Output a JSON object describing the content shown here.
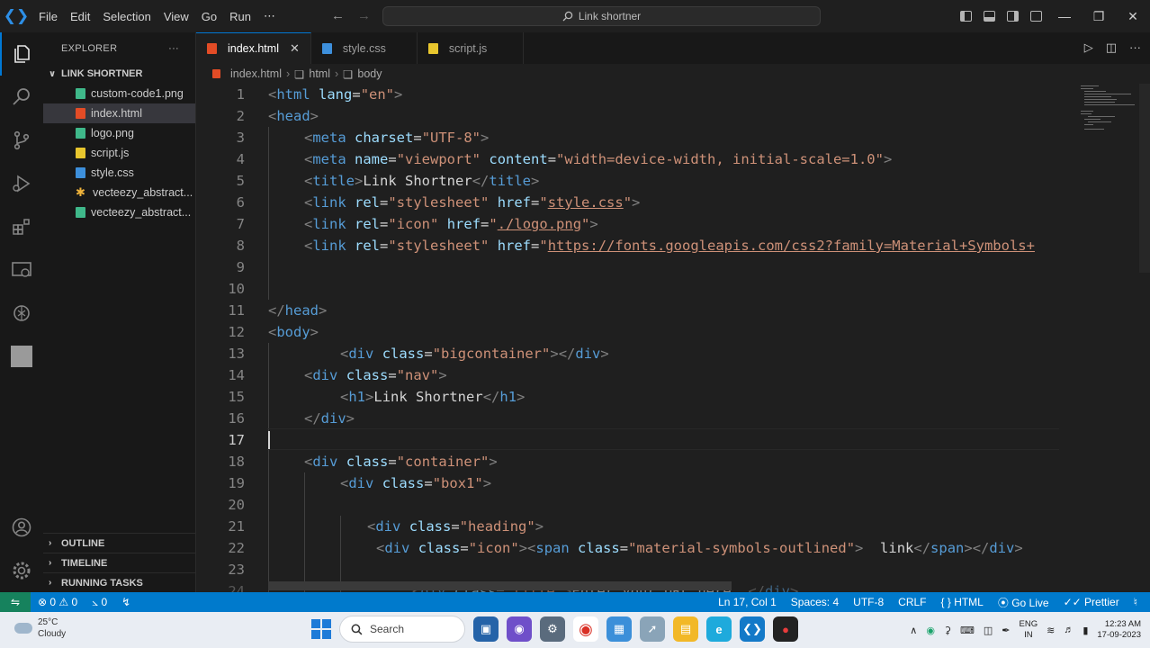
{
  "menu": [
    "File",
    "Edit",
    "Selection",
    "View",
    "Go",
    "Run",
    "⋯"
  ],
  "command_center": "Link shortner",
  "explorer": {
    "title": "EXPLORER",
    "more": "···",
    "folder": "LINK SHORTNER",
    "files": [
      {
        "name": "custom-code1.png",
        "type": "img"
      },
      {
        "name": "index.html",
        "type": "html",
        "selected": true
      },
      {
        "name": "logo.png",
        "type": "img"
      },
      {
        "name": "script.js",
        "type": "js"
      },
      {
        "name": "style.css",
        "type": "css"
      },
      {
        "name": "vecteezy_abstract...",
        "type": "star"
      },
      {
        "name": "vecteezy_abstract...",
        "type": "img"
      }
    ],
    "sections": [
      "OUTLINE",
      "TIMELINE",
      "RUNNING TASKS"
    ]
  },
  "tabs": [
    {
      "label": "index.html",
      "active": true,
      "type": "html"
    },
    {
      "label": "style.css",
      "active": false,
      "type": "css"
    },
    {
      "label": "script.js",
      "active": false,
      "type": "js"
    }
  ],
  "breadcrumbs": [
    "index.html",
    "html",
    "body"
  ],
  "code_lines": [
    {
      "n": "1"
    },
    {
      "n": "2"
    },
    {
      "n": "3"
    },
    {
      "n": "4"
    },
    {
      "n": "5"
    },
    {
      "n": "6"
    },
    {
      "n": "7"
    },
    {
      "n": "8"
    },
    {
      "n": "9"
    },
    {
      "n": "10"
    },
    {
      "n": "11"
    },
    {
      "n": "12"
    },
    {
      "n": "13"
    },
    {
      "n": "14"
    },
    {
      "n": "15"
    },
    {
      "n": "16"
    },
    {
      "n": "17"
    },
    {
      "n": "18"
    },
    {
      "n": "19"
    },
    {
      "n": "20"
    },
    {
      "n": "21"
    },
    {
      "n": "22"
    },
    {
      "n": "23"
    },
    {
      "n": "24"
    }
  ],
  "code": {
    "l1": [
      "<",
      "html",
      " ",
      "lang",
      "=",
      "\"en\"",
      ">"
    ],
    "l2": [
      "<",
      "head",
      ">"
    ],
    "l3": [
      "<",
      "meta",
      " ",
      "charset",
      "=",
      "\"UTF-8\"",
      ">"
    ],
    "l4": [
      "<",
      "meta",
      " ",
      "name",
      "=",
      "\"viewport\"",
      " ",
      "content",
      "=",
      "\"width=device-width, initial-scale=1.0\"",
      ">"
    ],
    "l5": [
      "<",
      "title",
      ">",
      "Link Shortner",
      "</",
      "title",
      ">"
    ],
    "l6": [
      "<",
      "link",
      " ",
      "rel",
      "=",
      "\"stylesheet\"",
      " ",
      "href",
      "=",
      "\"",
      "style.css",
      "\"",
      ">"
    ],
    "l7": [
      "<",
      "link",
      " ",
      "rel",
      "=",
      "\"icon\"",
      " ",
      "href",
      "=",
      "\"",
      "./logo.png",
      "\"",
      ">"
    ],
    "l8": [
      "<",
      "link",
      " ",
      "rel",
      "=",
      "\"stylesheet\"",
      " ",
      "href",
      "=",
      "\"",
      "https://fonts.googleapis.com/css2?family=Material+Symbols+"
    ],
    "l11": [
      "</",
      "head",
      ">"
    ],
    "l12": [
      "<",
      "body",
      ">"
    ],
    "l13": [
      "<",
      "div",
      " ",
      "class",
      "=",
      "\"bigcontainer\"",
      "></",
      "div",
      ">"
    ],
    "l14": [
      "<",
      "div",
      " ",
      "class",
      "=",
      "\"nav\"",
      ">"
    ],
    "l15": [
      "<",
      "h1",
      ">",
      "Link Shortner",
      "</",
      "h1",
      ">"
    ],
    "l16": [
      "</",
      "div",
      ">"
    ],
    "l18": [
      "<",
      "div",
      " ",
      "class",
      "=",
      "\"container\"",
      ">"
    ],
    "l19": [
      "<",
      "div",
      " ",
      "class",
      "=",
      "\"box1\"",
      ">"
    ],
    "l21": [
      "<",
      "div",
      " ",
      "class",
      "=",
      "\"heading\"",
      ">"
    ],
    "l22": [
      "<",
      "div",
      " ",
      "class",
      "=",
      "\"icon\"",
      "><",
      "span",
      " ",
      "class",
      "=",
      "\"material-symbols-outlined\"",
      ">",
      "  link",
      "</",
      "span",
      "></",
      "div",
      ">"
    ],
    "l24": [
      "<",
      "div",
      " ",
      "class",
      "=",
      "\"title\"",
      ">",
      "Enter your URL here  ",
      "</",
      "div",
      ">"
    ]
  },
  "status": {
    "errors": "0",
    "warnings": "0",
    "ports": "0",
    "position": "Ln 17, Col 1",
    "spaces": "Spaces: 4",
    "encoding": "UTF-8",
    "eol": "CRLF",
    "language": "HTML",
    "golive": "Go Live",
    "prettier": "Prettier"
  },
  "taskbar": {
    "temp": "25°C",
    "weather": "Cloudy",
    "search": "Search",
    "lang1": "ENG",
    "lang2": "IN",
    "time": "12:23 AM",
    "date": "17-09-2023"
  }
}
